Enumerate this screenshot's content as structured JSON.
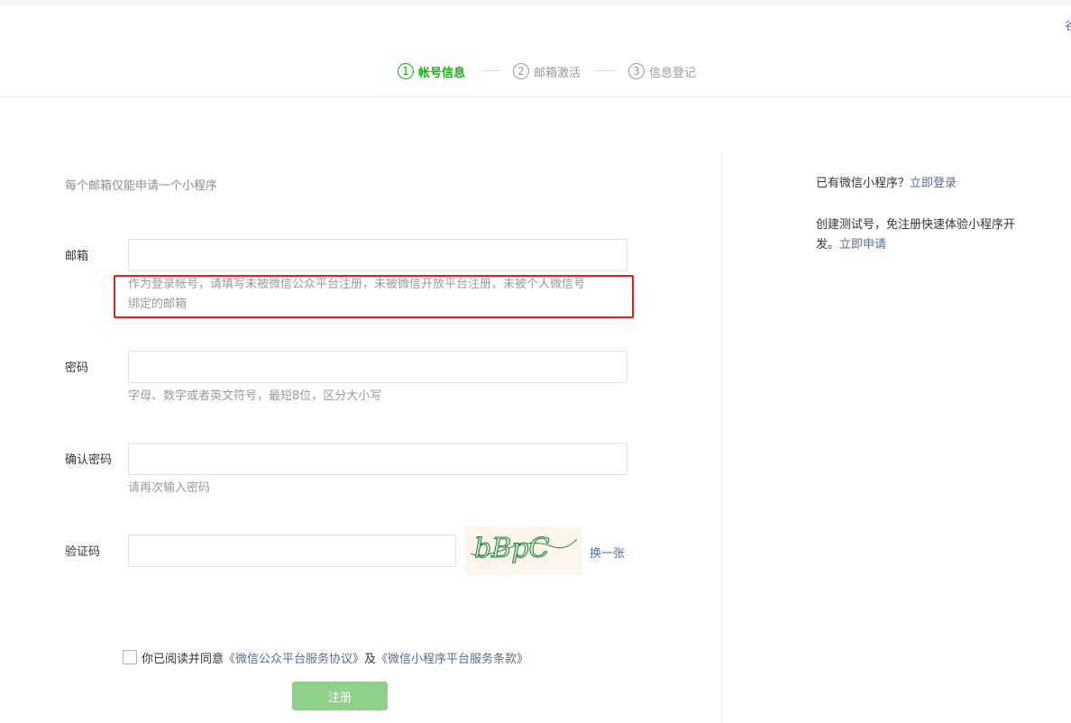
{
  "corner_glyph": "谷",
  "steps": [
    {
      "num": "1",
      "label": "帐号信息"
    },
    {
      "num": "2",
      "label": "邮箱激活"
    },
    {
      "num": "3",
      "label": "信息登记"
    }
  ],
  "form": {
    "tip": "每个邮箱仅能申请一个小程序",
    "email": {
      "label": "邮箱",
      "value": "",
      "hint_line1": "作为登录帐号，请填写未被微信公众平台注册，未被微信开放平台注册，未被个人微信号",
      "hint_line2": "绑定的邮箱"
    },
    "password": {
      "label": "密码",
      "value": "",
      "hint": "字母、数字或者英文符号，最短8位，区分大小写"
    },
    "confirm": {
      "label": "确认密码",
      "value": "",
      "hint": "请再次输入密码"
    },
    "captcha": {
      "label": "验证码",
      "value": "",
      "image_text": "bBpC",
      "refresh": "换一张"
    },
    "agreement": {
      "prefix": "你已阅读并同意",
      "link1": "《微信公众平台服务协议》",
      "mid": "及",
      "link2": "《微信小程序平台服务条款》"
    },
    "submit": "注册"
  },
  "side": {
    "login_prefix": "已有微信小程序？",
    "login_link": "立即登录",
    "test_line1": "创建测试号，免注册快速体验小程序开",
    "test_line2_prefix": "发。",
    "test_link": "立即申请"
  },
  "colors": {
    "accent_green": "#1aad19",
    "link_blue": "#576b95",
    "highlight_red": "#e2211c",
    "button_disabled": "#8fd08a"
  }
}
